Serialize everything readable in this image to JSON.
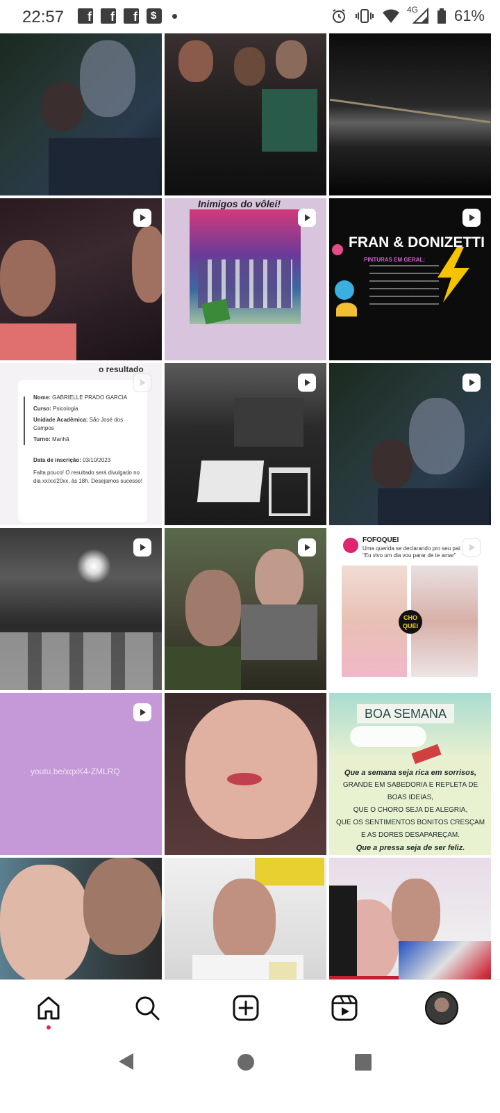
{
  "status_bar": {
    "time": "22:57",
    "network": "4G",
    "battery": "61%",
    "icons_left": [
      "facebook-icon",
      "facebook-icon",
      "facebook-icon",
      "shopping-bag-icon",
      "notification-dot-icon"
    ],
    "icons_right": [
      "alarm-icon",
      "vibrate-icon",
      "wifi-icon",
      "signal-icon",
      "battery-icon"
    ]
  },
  "grid": {
    "tile_2_2": {
      "title": "Inimigos do vôlei!"
    },
    "tile_2_3": {
      "title": "FRAN & DONIZETTI",
      "subtitle": "PINTURAS EM GERAL:"
    },
    "tile_3_1": {
      "header": "o resultado",
      "fields": [
        {
          "label": "Nome:",
          "value": "GABRIELLE PRADO GARCIA"
        },
        {
          "label": "Curso:",
          "value": "Psicologia"
        },
        {
          "label": "Unidade Acadêmica:",
          "value": "São José dos Campos"
        },
        {
          "label": "Turno:",
          "value": "Manhã"
        }
      ],
      "date_label": "Data de inscrição:",
      "date_value": "03/10/2023",
      "note": "Falta pouco! O resultado será divulgado no dia xx/xx/20xx, às 18h. Desejamos sucesso!"
    },
    "tile_4_3": {
      "account": "FOFOQUEI",
      "caption": "Uma querida se declarando pro seu pai: \"Eu vivo um dia vou parar de te amar\"",
      "badge": "CHO QUEI"
    },
    "tile_5_1": {
      "link": "youtu.be/xqxK4-ZMLRQ"
    },
    "tile_5_3": {
      "title": "BOA SEMANA",
      "lines": [
        "Que a semana seja rica em sorrisos,",
        "GRANDE EM SABEDORIA E REPLETA DE BOAS IDEIAS,",
        "QUE O CHORO SEJA DE ALEGRIA,",
        "QUE OS SENTIMENTOS BONITOS CRESÇAM",
        "E AS DORES DESAPAREÇAM.",
        "Que a pressa seja de ser feliz."
      ]
    }
  },
  "bottom_nav": {
    "items": [
      "home-icon",
      "search-icon",
      "create-post-icon",
      "reels-icon",
      "profile-avatar"
    ]
  },
  "system_nav": {
    "items": [
      "back-button",
      "home-button",
      "recents-button"
    ]
  },
  "colors": {
    "active_dot": "#e0245e",
    "purple_tile": "#c598d8",
    "status_text": "#3a3a3a"
  }
}
